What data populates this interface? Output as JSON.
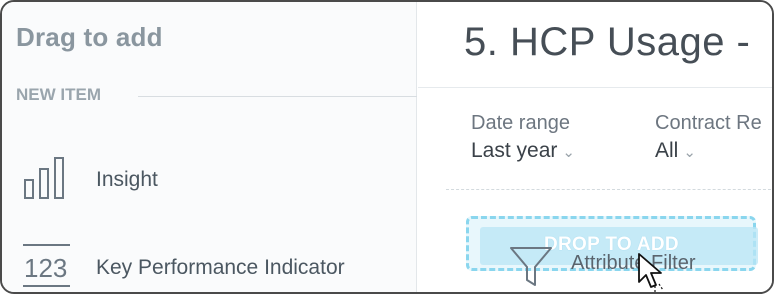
{
  "left_panel": {
    "title": "Drag to add",
    "section_label": "NEW ITEM",
    "items": [
      {
        "label": "Insight",
        "icon": "bar-chart-icon"
      },
      {
        "label": "Key Performance Indicator",
        "icon": "kpi-123-icon"
      }
    ]
  },
  "dashboard": {
    "title": "5. HCP Usage -",
    "filters": [
      {
        "label": "Date range",
        "value": "Last year"
      },
      {
        "label": "Contract Re",
        "value": "All"
      }
    ],
    "dropzone": {
      "text": "DROP TO ADD"
    },
    "drag_preview": {
      "label": "Attribute Filter",
      "icon": "funnel-icon"
    }
  },
  "colors": {
    "accent": "#8ad6ee",
    "panel_bg": "#fafbfc",
    "text_muted": "#8a969f"
  }
}
